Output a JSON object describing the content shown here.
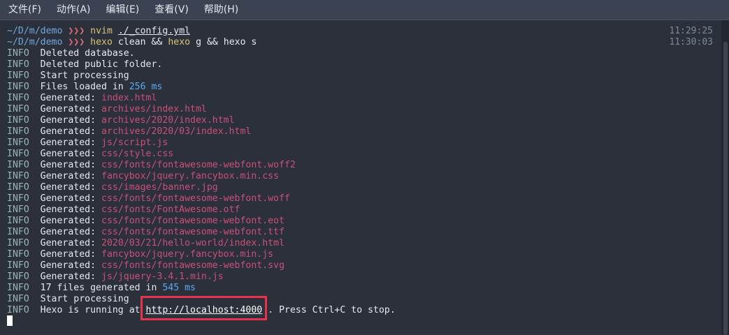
{
  "menu": [
    {
      "label": "文件(F)"
    },
    {
      "label": "动作(A)"
    },
    {
      "label": "编辑(E)"
    },
    {
      "label": "查看(V)"
    },
    {
      "label": "帮助(H)"
    }
  ],
  "prompts": [
    {
      "path": "~/D/m/demo",
      "arrows": "❯❯❯",
      "cmd1": "nvim",
      "arg1": "./_config.yml",
      "mid": "",
      "cmd2": "",
      "tail": "",
      "time": "11:29:25"
    },
    {
      "path": "~/D/m/demo",
      "arrows": "❯❯❯",
      "cmd1": "hexo",
      "arg1": "clean &&",
      "mid": " ",
      "cmd2": "hexo",
      "tail": "g && hexo s",
      "time": "11:30:03"
    }
  ],
  "level": "INFO",
  "plain_lines": [
    {
      "text": "Deleted database."
    },
    {
      "text": "Deleted public folder."
    },
    {
      "text": "Start processing"
    }
  ],
  "loaded": {
    "prefix": "Files loaded in ",
    "value": "256 ms"
  },
  "generated_label": "Generated: ",
  "generated_files": [
    "index.html",
    "archives/index.html",
    "archives/2020/index.html",
    "archives/2020/03/index.html",
    "js/script.js",
    "css/style.css",
    "css/fonts/fontawesome-webfont.woff2",
    "fancybox/jquery.fancybox.min.css",
    "css/images/banner.jpg",
    "css/fonts/fontawesome-webfont.woff",
    "css/fonts/FontAwesome.otf",
    "css/fonts/fontawesome-webfont.eot",
    "css/fonts/fontawesome-webfont.ttf",
    "2020/03/21/hello-world/index.html",
    "fancybox/jquery.fancybox.min.js",
    "css/fonts/fontawesome-webfont.svg",
    "js/jquery-3.4.1.min.js"
  ],
  "summary": {
    "prefix": "17 files generated in ",
    "value": "545 ms"
  },
  "start2": "Start processing",
  "running": {
    "prefix": "Hexo is running at ",
    "url": "http://localhost:4000",
    "suffix": " . Press Ctrl+C to stop."
  },
  "colors": {
    "background": "#2b303b",
    "info": "#96b5b4",
    "file": "#c8517a",
    "number": "#5aaaf0",
    "highlight": "#e8344a"
  }
}
